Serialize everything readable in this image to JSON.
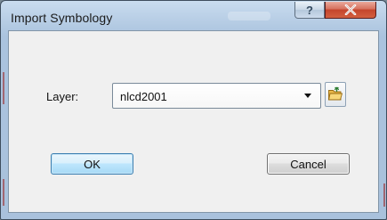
{
  "window": {
    "title": "Import Symbology",
    "help_glyph": "?",
    "close_icon": "close-x-icon",
    "close_color": "#c4452c"
  },
  "form": {
    "layer_label": "Layer:",
    "layer_value": "nlcd2001",
    "browse_icon": "folder-open-icon"
  },
  "buttons": {
    "ok_label": "OK",
    "cancel_label": "Cancel"
  },
  "colors": {
    "frame": "#a9c1dc",
    "client": "#f0f0f0",
    "default_button_border": "#3c7fb1"
  }
}
